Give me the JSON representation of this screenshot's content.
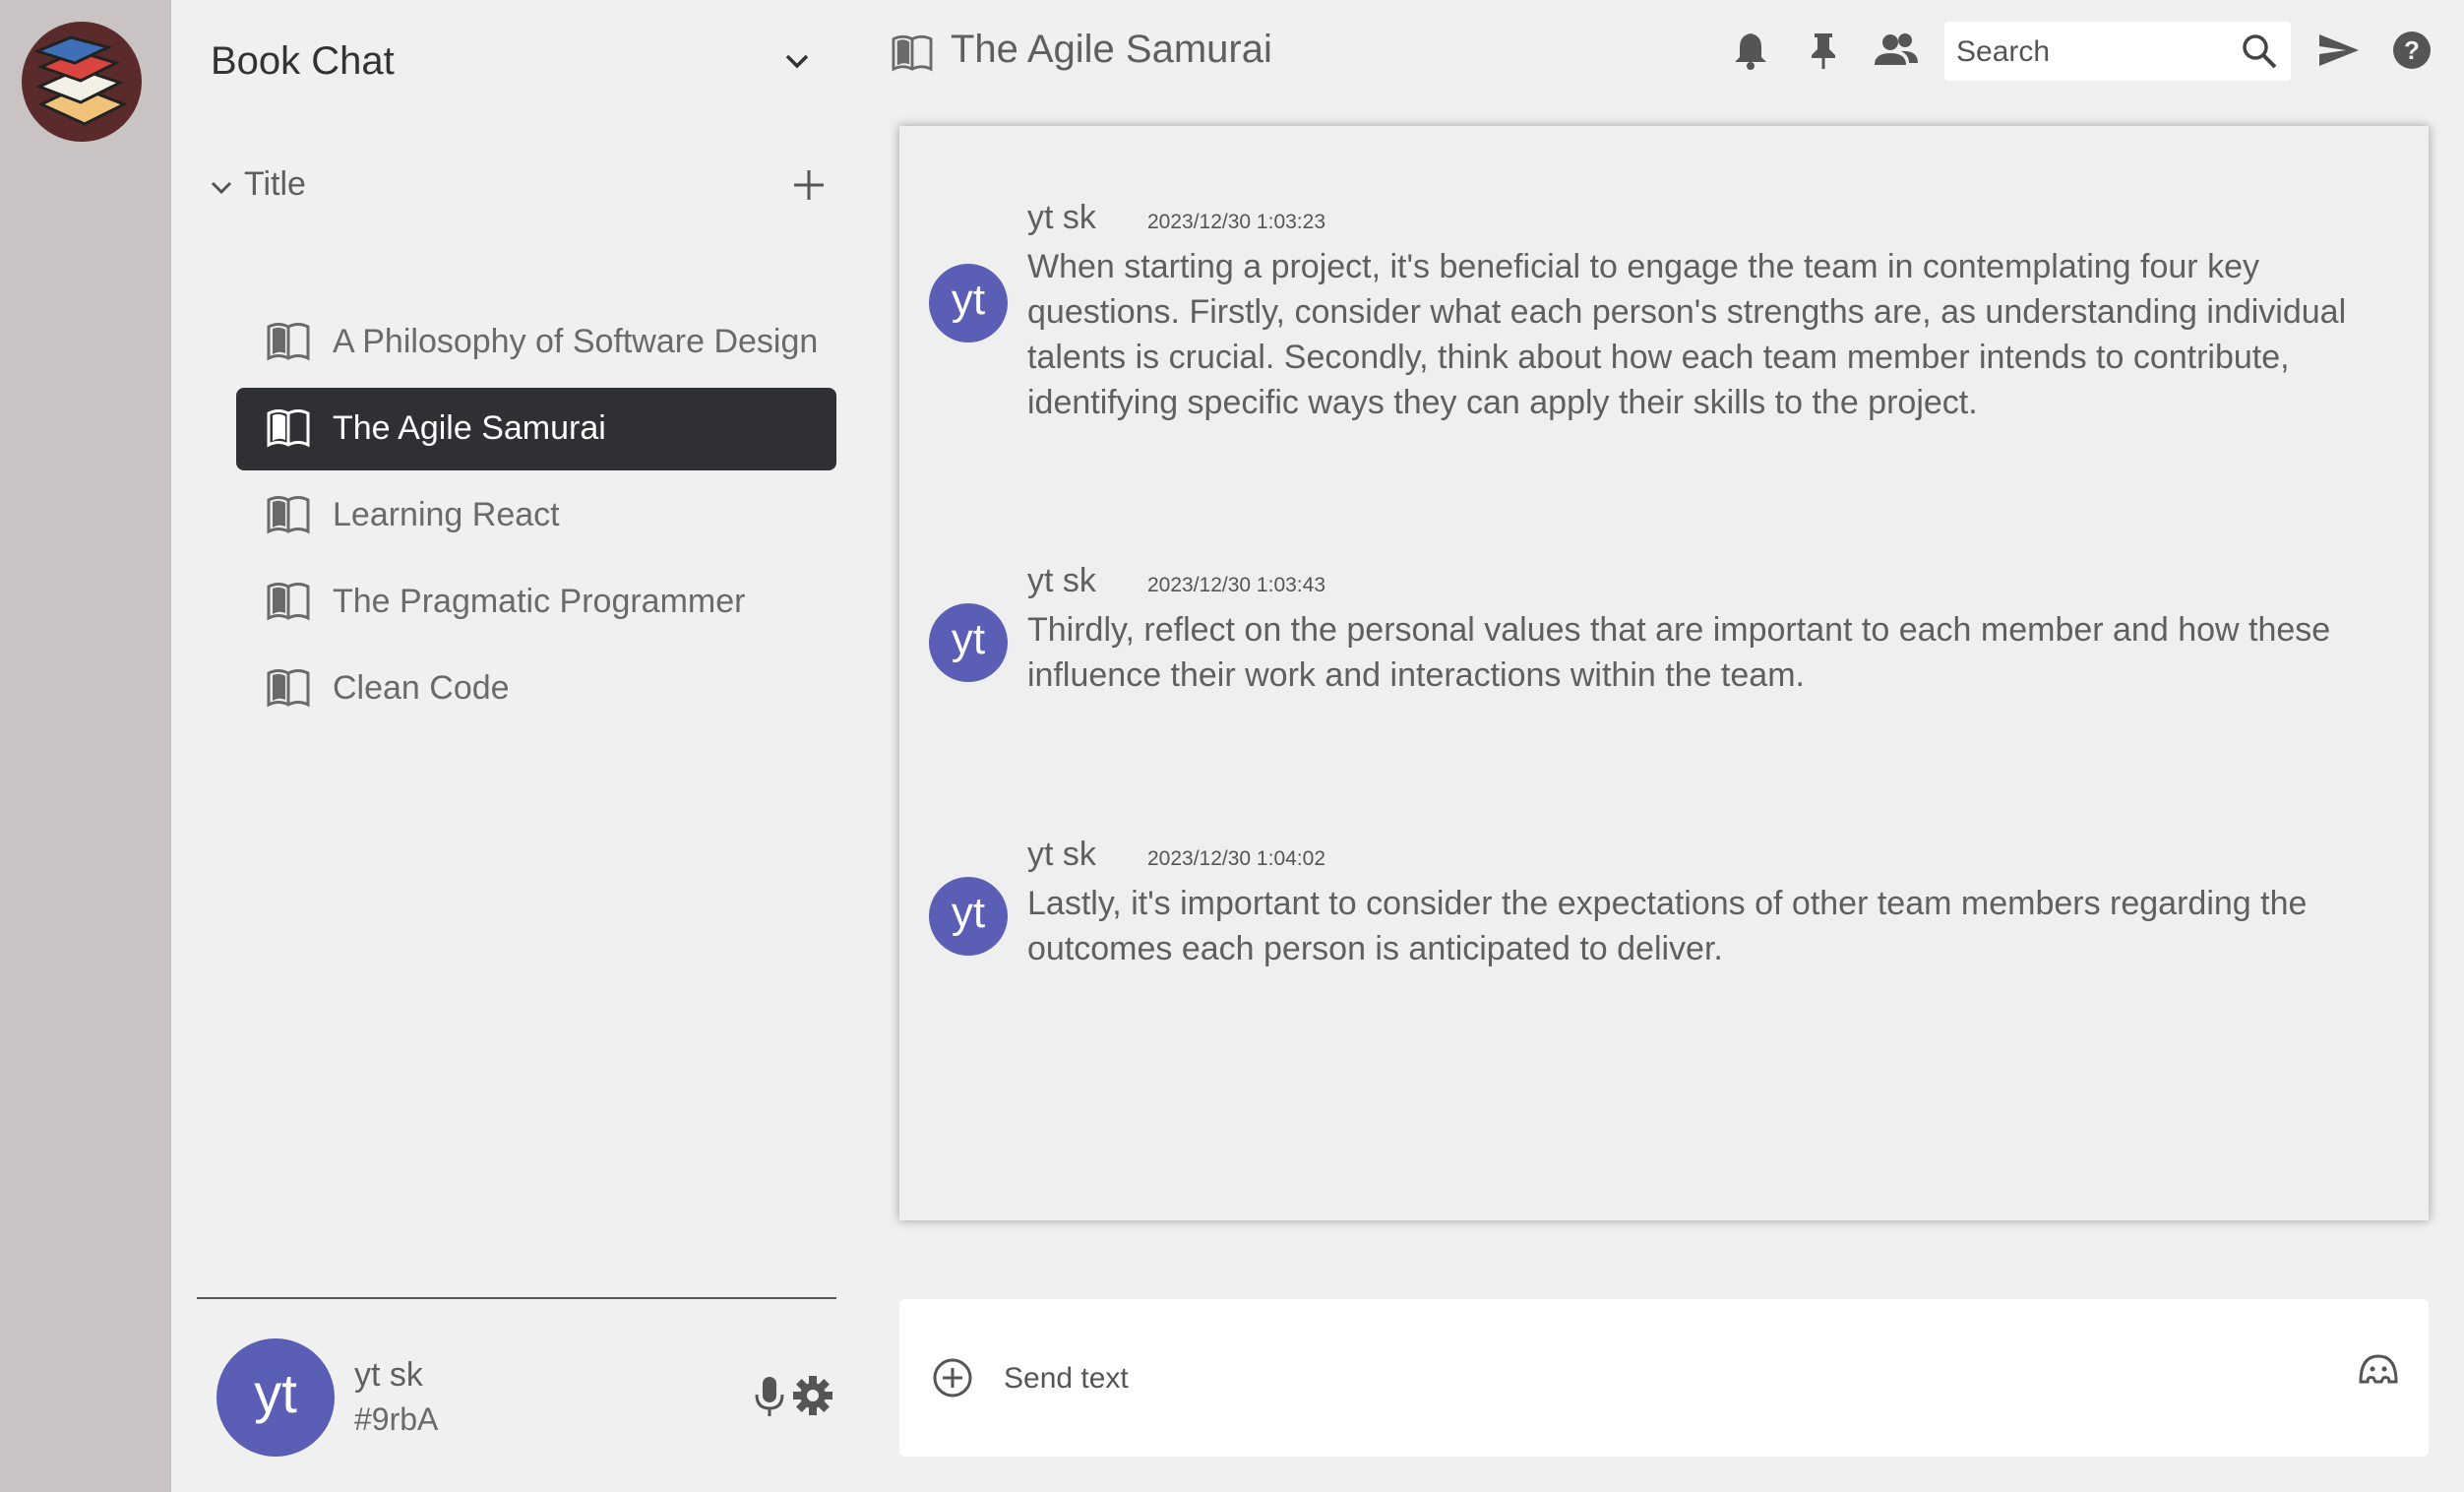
{
  "server": {
    "name": "Book Chat"
  },
  "category": {
    "label": "Title"
  },
  "channels": [
    {
      "name": "A Philosophy of Software Design",
      "active": false
    },
    {
      "name": "The Agile Samurai",
      "active": true
    },
    {
      "name": "Learning React",
      "active": false
    },
    {
      "name": "The Pragmatic Programmer",
      "active": false
    },
    {
      "name": "Clean Code",
      "active": false
    }
  ],
  "user": {
    "avatar_initials": "yt",
    "name": "yt sk",
    "tag": "#9rbA"
  },
  "header": {
    "channel_title": "The Agile Samurai",
    "search_placeholder": "Search",
    "icons": [
      "bell-icon",
      "pin-icon",
      "members-icon",
      "search-icon",
      "send-icon",
      "help-icon"
    ]
  },
  "messages": [
    {
      "avatar_initials": "yt",
      "author": "yt sk",
      "time": "2023/12/30 1:03:23",
      "text": "When starting a project, it's beneficial to engage the team in contemplating four key questions. Firstly, consider what each person's strengths are, as understanding individual talents is crucial. Secondly, think about how each team member intends to contribute, identifying specific ways they can apply their skills to the project."
    },
    {
      "avatar_initials": "yt",
      "author": "yt sk",
      "time": "2023/12/30 1:03:43",
      "text": "Thirdly, reflect on the personal values that are important to each member and how these influence their work and interactions within the team."
    },
    {
      "avatar_initials": "yt",
      "author": "yt sk",
      "time": "2023/12/30 1:04:02",
      "text": "Lastly, it's important to consider the expectations of other team members regarding the outcomes each person is anticipated to deliver."
    }
  ],
  "composer": {
    "placeholder": "Send text"
  },
  "colors": {
    "rail": "#c9c3c3",
    "sidebar": "#f0f0f0",
    "active_channel": "#2f3033",
    "avatar": "#5a5fb5"
  }
}
